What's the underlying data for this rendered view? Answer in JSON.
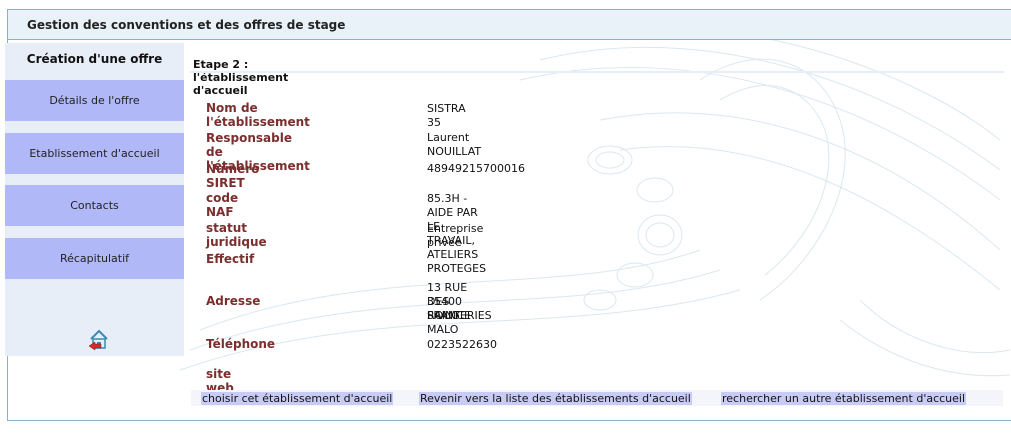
{
  "header": {
    "title": "Gestion des conventions et des offres de stage"
  },
  "sidebar": {
    "title": "Création d'une offre",
    "items": [
      {
        "label": "Détails de l'offre"
      },
      {
        "label": "Etablissement d'accueil"
      },
      {
        "label": "Contacts"
      },
      {
        "label": "Récapitulatif"
      }
    ],
    "home_icon": "home-return-icon"
  },
  "main": {
    "step_title": "Etape 2 : l'établissement d'accueil",
    "fields": [
      {
        "label": "Nom de l'établissement",
        "value": "SISTRA 35"
      },
      {
        "label": "Responsable de l'établissement",
        "value": "Laurent NOUILLAT"
      },
      {
        "label": "Numero SIRET",
        "value": "48949215700016"
      },
      {
        "label": "code NAF",
        "value": "85.3H - AIDE PAR LE TRAVAIL, ATELIERS PROTEGES"
      },
      {
        "label": "statut juridique",
        "value": "Entreprise privée"
      },
      {
        "label": "Effectif",
        "value": ""
      },
      {
        "label": "Adresse",
        "value_lines": [
          "13 RUE DES ROUGERIES",
          "35400 SAINT MALO",
          "FRANCE"
        ]
      },
      {
        "label": "Téléphone",
        "value": "0223522630"
      },
      {
        "label": "site web",
        "value": ""
      }
    ]
  },
  "actions": {
    "choose": "choisir cet établissement d'accueil",
    "back_to_list": "Revenir vers la liste des établissements d'accueil",
    "search_other": "rechercher un autre établissement d'accueil"
  },
  "colors": {
    "accent_nav": "#b0b8f8",
    "label_color": "#7a2e2e",
    "header_bg": "#e9f2f8",
    "border": "#8fb0c4"
  }
}
